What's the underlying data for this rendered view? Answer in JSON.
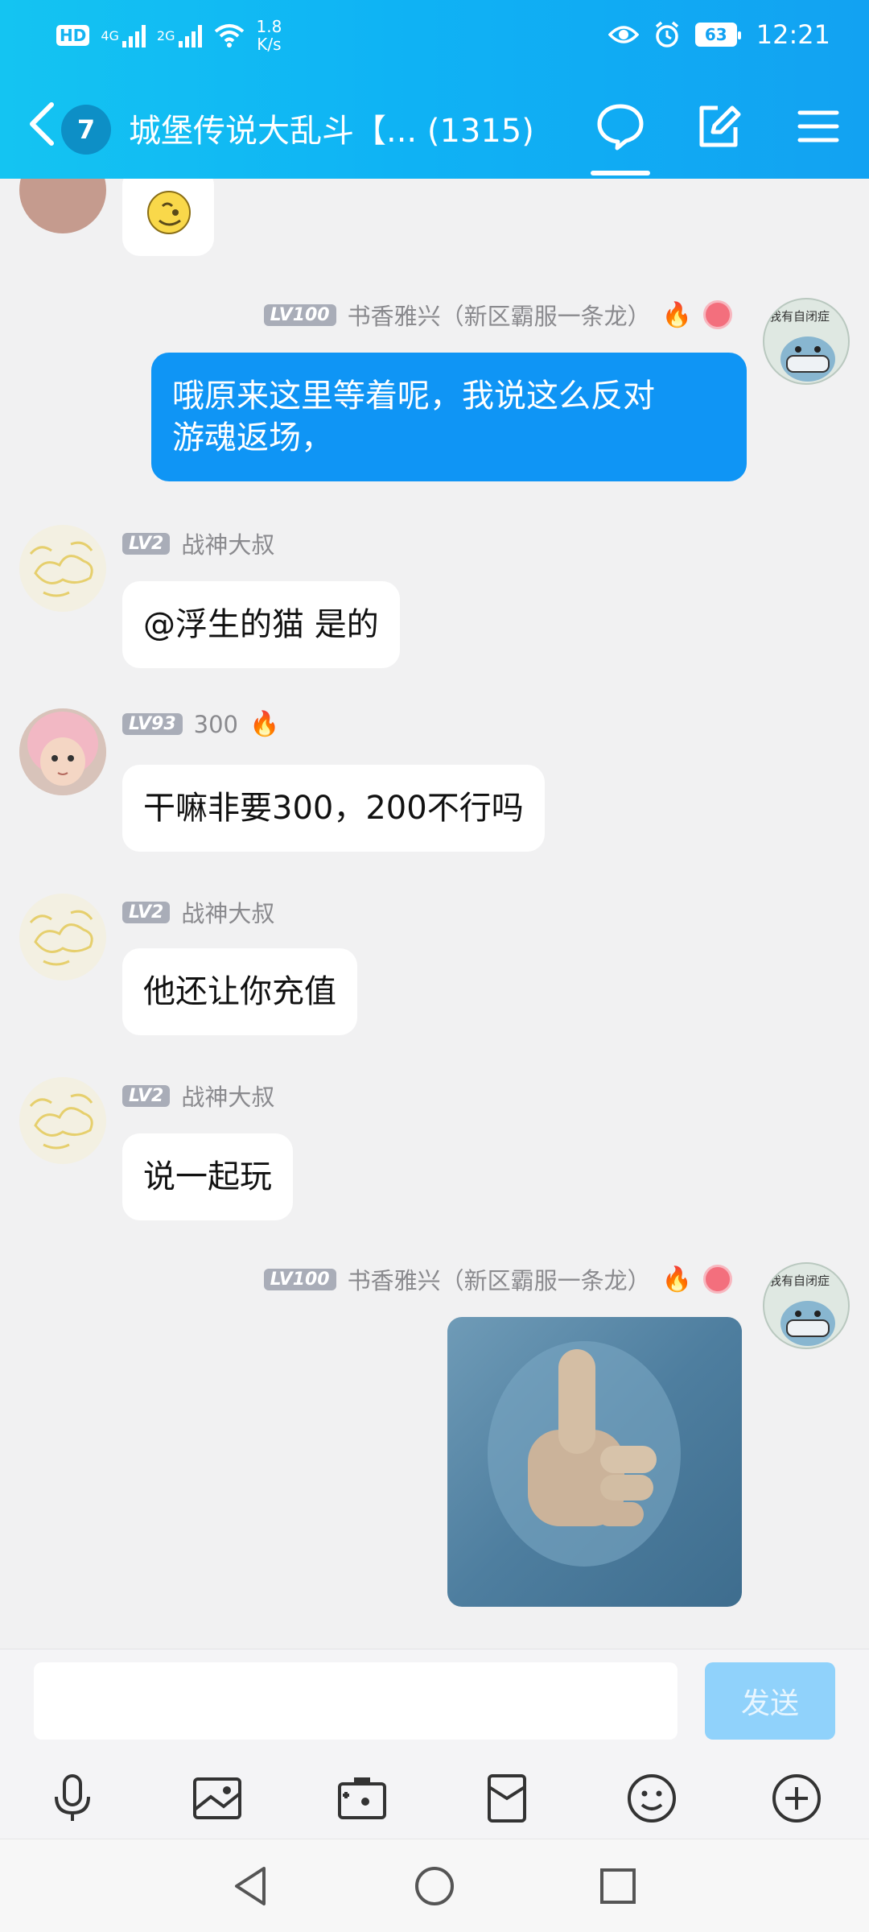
{
  "status_bar": {
    "hd": "HD",
    "net1": "4G",
    "net2": "2G",
    "speed": "1.8",
    "speed_unit": "K/s",
    "battery": "63",
    "time": "12:21"
  },
  "header": {
    "unread_count": "7",
    "title": "城堡传说大乱斗【... (1315)"
  },
  "messages": [
    {
      "side": "out",
      "level": "LV100",
      "name": "书香雅兴（新区霸服一条龙）",
      "text": "哦原来这里等着呢，我说这么反对\n游魂返场，"
    },
    {
      "side": "in",
      "level": "LV2",
      "name": "战神大叔",
      "text": "@浮生的猫 是的"
    },
    {
      "side": "in",
      "level": "LV93",
      "name": "300",
      "text": "干嘛非要300，200不行吗"
    },
    {
      "side": "in",
      "level": "LV2",
      "name": "战神大叔",
      "text": "他还让你充值"
    },
    {
      "side": "in",
      "level": "LV2",
      "name": "战神大叔",
      "text": "说一起玩"
    },
    {
      "side": "out",
      "level": "LV100",
      "name": "书香雅兴（新区霸服一条龙）",
      "image": "thumbs-up-image"
    }
  ],
  "avatar_text": "我有自闭症",
  "input": {
    "placeholder": "",
    "send_label": "发送"
  },
  "toolbar_icons": [
    "mic-icon",
    "image-icon",
    "camera-icon",
    "red-packet-icon",
    "emoji-icon",
    "plus-icon"
  ],
  "colors": {
    "header": "#12a2f2",
    "out_bubble": "#0f95f5",
    "send_disabled": "#90d2fb"
  }
}
